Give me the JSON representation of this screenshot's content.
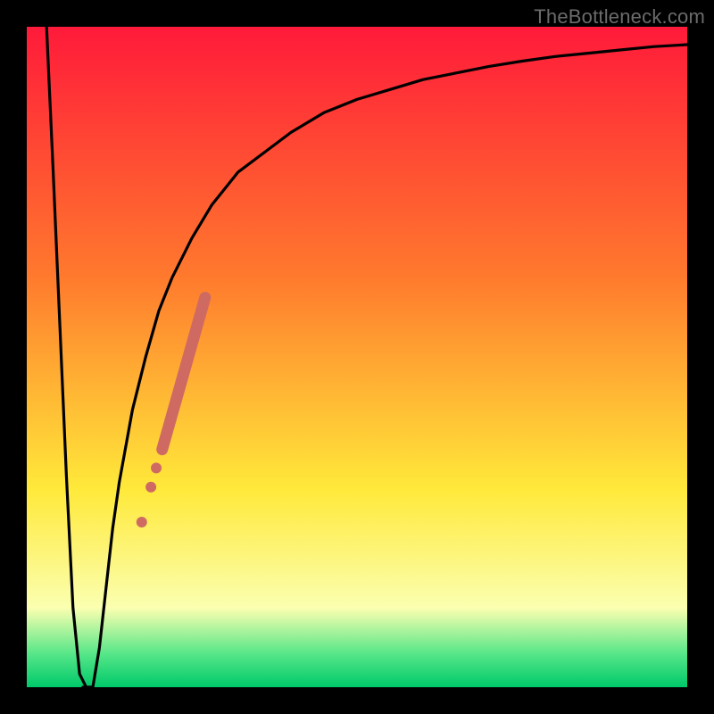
{
  "watermark": "TheBottleneck.com",
  "colors": {
    "frame": "#000000",
    "gradient_top": "#ff1a3a",
    "gradient_mid1": "#ff7a2d",
    "gradient_mid2": "#ffe93a",
    "gradient_mid3": "#fbffb0",
    "gradient_bottom_band": "#55e688",
    "gradient_bottom": "#00c96a",
    "curve": "#000000",
    "markers": "#cf6a63"
  },
  "chart_data": {
    "type": "line",
    "title": "",
    "xlabel": "",
    "ylabel": "",
    "xlim": [
      0,
      100
    ],
    "ylim": [
      0,
      100
    ],
    "curve": {
      "description": "Bottleneck percentage curve with a sharp minimum near the low end and asymptotic rise toward 100%",
      "x": [
        3,
        4,
        5,
        6,
        7,
        8,
        9,
        10,
        11,
        12,
        13,
        14,
        16,
        18,
        20,
        22,
        25,
        28,
        32,
        36,
        40,
        45,
        50,
        55,
        60,
        65,
        70,
        75,
        80,
        85,
        90,
        95,
        100
      ],
      "y": [
        100,
        78,
        55,
        32,
        12,
        2,
        0,
        0,
        6,
        15,
        24,
        31,
        42,
        50,
        57,
        62,
        68,
        73,
        78,
        81,
        84,
        87,
        89,
        90.5,
        92,
        93,
        94,
        94.8,
        95.5,
        96,
        96.5,
        97,
        97.3
      ]
    },
    "flat_minimum": {
      "x_start": 8.5,
      "x_end": 10,
      "y": 0
    },
    "series": [
      {
        "name": "highlight-segment",
        "kind": "thick-overlay",
        "x_start": 20.5,
        "x_end": 27,
        "y_start": 36,
        "y_end": 59,
        "stroke_width": 13
      }
    ],
    "markers": [
      {
        "x": 17.4,
        "y": 25.0,
        "r": 6
      },
      {
        "x": 18.8,
        "y": 30.3,
        "r": 6
      },
      {
        "x": 19.6,
        "y": 33.2,
        "r": 6
      }
    ],
    "annotations": []
  }
}
